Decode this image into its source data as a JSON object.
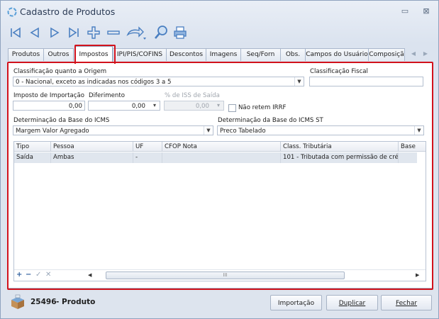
{
  "window": {
    "title": "Cadastro de Produtos",
    "minimize_glyph": "▭",
    "close_glyph": "⊠"
  },
  "toolbar": [
    "first-icon",
    "prev-icon",
    "next-icon",
    "last-icon",
    "add-icon",
    "remove-icon",
    "undo-icon",
    "search-icon",
    "print-icon"
  ],
  "tabs": [
    {
      "label": "Produtos"
    },
    {
      "label": "Outros"
    },
    {
      "label": "Impostos"
    },
    {
      "label": "IPI/PIS/COFINS"
    },
    {
      "label": "Descontos"
    },
    {
      "label": "Imagens"
    },
    {
      "label": "Seq/Forn"
    },
    {
      "label": "Obs."
    },
    {
      "label": "Campos do Usuário"
    },
    {
      "label": "Composiçã"
    }
  ],
  "form": {
    "origem_label": "Classificação quanto a Origem",
    "origem_value": "0 - Nacional, exceto as indicadas nos códigos 3 a 5",
    "fiscal_label": "Classificação Fiscal",
    "fiscal_value": "",
    "import_label": "Imposto de Importação",
    "import_value": "0,00",
    "difer_label": "Diferimento",
    "difer_value": "0,00",
    "iss_label": "% de ISS de Saída",
    "iss_value": "0,00",
    "irrf_label": "Não retem IRRF",
    "base_icms_label": "Determinação da Base do ICMS",
    "base_icms_value": "Margem Valor Agregado",
    "base_st_label": "Determinação da Base do ICMS ST",
    "base_st_value": "Preco Tabelado"
  },
  "grid": {
    "columns": [
      "Tipo",
      "Pessoa",
      "UF",
      "CFOP Nota",
      "Class. Tributária",
      "Base"
    ],
    "rows": [
      [
        "Saída",
        "Ambas",
        "-",
        "",
        "101 - Tributada com permissão de cré...",
        ""
      ]
    ],
    "footer_icons": [
      "+",
      "−",
      "✓",
      "✕"
    ],
    "scroll_grip": "III"
  },
  "footer": {
    "product_code": "25496",
    "product_label": "- Produto",
    "import_btn": "Importação",
    "duplicate_btn": "Duplicar",
    "close_btn": "Fechar"
  }
}
